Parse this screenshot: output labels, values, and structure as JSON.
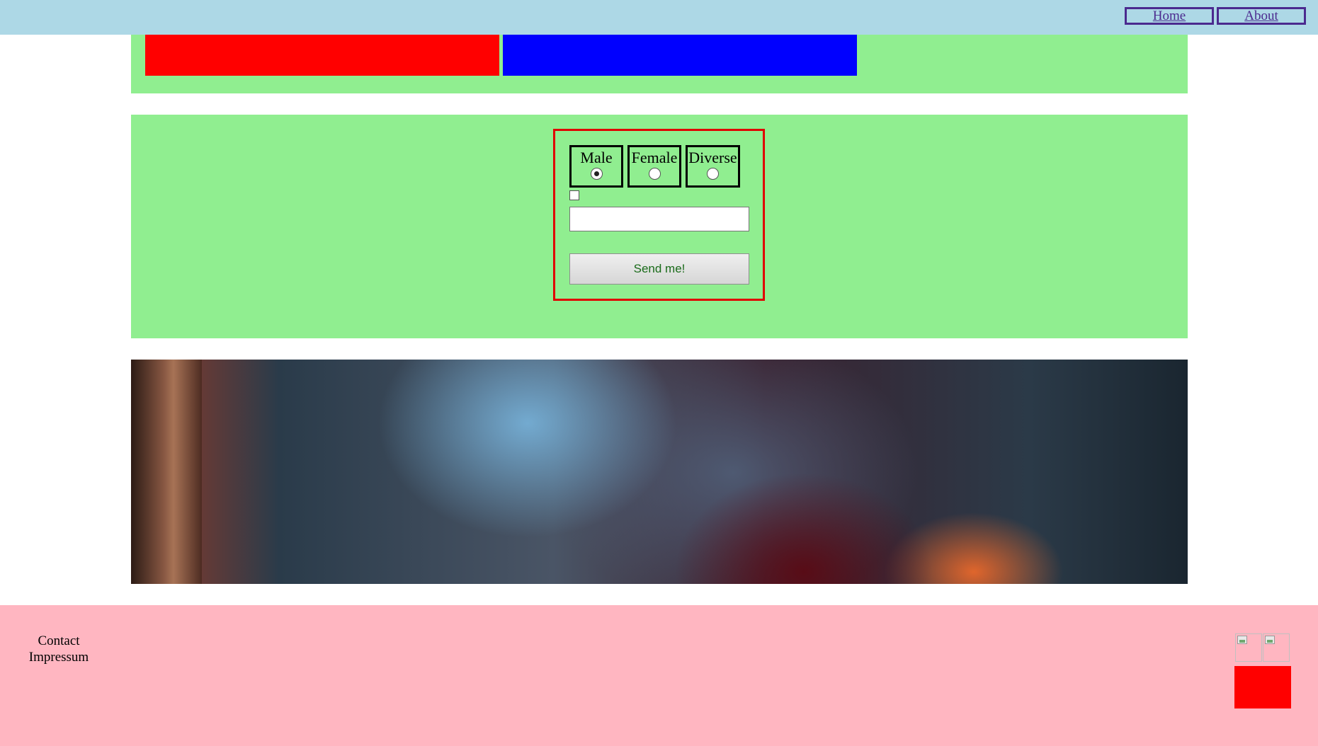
{
  "nav": {
    "home_label": "Home",
    "about_label": "About"
  },
  "form": {
    "gender_options": [
      {
        "label": "Male",
        "checked": true
      },
      {
        "label": "Female",
        "checked": false
      },
      {
        "label": "Diverse",
        "checked": false
      }
    ],
    "checkbox_checked": false,
    "text_value": "",
    "submit_label": "Send me!"
  },
  "footer": {
    "contact_label": "Contact",
    "impressum_label": "Impressum"
  },
  "colors": {
    "topbar": "#add8e6",
    "section_bg": "#90ee90",
    "footer_bg": "#ffb6c1",
    "red_box": "#ff0000",
    "blue_box": "#0000ff",
    "form_border": "#e00000",
    "nav_link": "#4b2a8f"
  },
  "images": {
    "banner_icon": "fantasy-wolf-banner-image",
    "footer_icons": [
      "broken-image-icon",
      "broken-image-icon"
    ]
  }
}
